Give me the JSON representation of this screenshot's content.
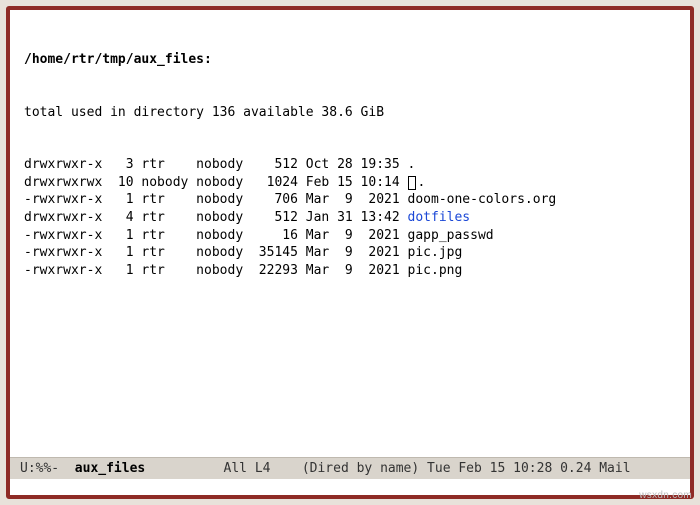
{
  "path_header": "/home/rtr/tmp/aux_files:",
  "summary": "total used in directory 136 available 38.6 GiB",
  "entries": [
    {
      "perm": "drwxrwxr-x",
      "links": "3",
      "owner": "rtr",
      "group": "nobody",
      "size": "512",
      "date": "Oct 28 19:35",
      "name": ".",
      "dir": false,
      "cursor": false
    },
    {
      "perm": "drwxrwxrwx",
      "links": "10",
      "owner": "nobody",
      "group": "nobody",
      "size": "1024",
      "date": "Feb 15 10:14",
      "name": ".",
      "dir": false,
      "cursor": true
    },
    {
      "perm": "-rwxrwxr-x",
      "links": "1",
      "owner": "rtr",
      "group": "nobody",
      "size": "706",
      "date": "Mar  9  2021",
      "name": "doom-one-colors.org",
      "dir": false,
      "cursor": false
    },
    {
      "perm": "drwxrwxr-x",
      "links": "4",
      "owner": "rtr",
      "group": "nobody",
      "size": "512",
      "date": "Jan 31 13:42",
      "name": "dotfiles",
      "dir": true,
      "cursor": false
    },
    {
      "perm": "-rwxrwxr-x",
      "links": "1",
      "owner": "rtr",
      "group": "nobody",
      "size": "16",
      "date": "Mar  9  2021",
      "name": "gapp_passwd",
      "dir": false,
      "cursor": false
    },
    {
      "perm": "-rwxrwxr-x",
      "links": "1",
      "owner": "rtr",
      "group": "nobody",
      "size": "35145",
      "date": "Mar  9  2021",
      "name": "pic.jpg",
      "dir": false,
      "cursor": false
    },
    {
      "perm": "-rwxrwxr-x",
      "links": "1",
      "owner": "rtr",
      "group": "nobody",
      "size": "22293",
      "date": "Mar  9  2021",
      "name": "pic.png",
      "dir": false,
      "cursor": false
    }
  ],
  "modeline": {
    "left": "U:%%-",
    "buffer": "aux_files",
    "position": "All L4",
    "mode": "(Dired by name)",
    "right": "Tue Feb 15 10:28 0.24 Mail"
  },
  "watermark": "wsxdn.com"
}
